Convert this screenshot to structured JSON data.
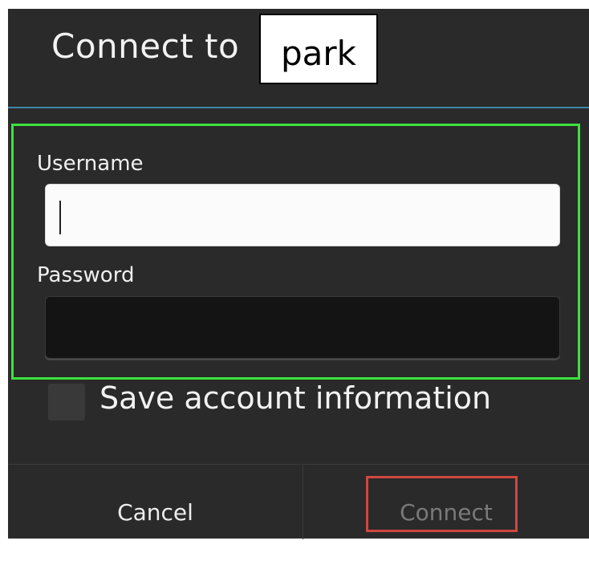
{
  "dialog": {
    "title": "Connect to",
    "network_name": "park"
  },
  "form": {
    "username_label": "Username",
    "username_value": "",
    "password_label": "Password",
    "password_value": ""
  },
  "save_account": {
    "label": "Save account information",
    "checked": false
  },
  "buttons": {
    "cancel_label": "Cancel",
    "connect_label": "Connect",
    "connect_enabled": false
  },
  "colors": {
    "dialog_background": "#2a2a2a",
    "title_divider": "#3f86a6",
    "fields_highlight": "#3ce23c",
    "connect_highlight": "#d0473f"
  }
}
